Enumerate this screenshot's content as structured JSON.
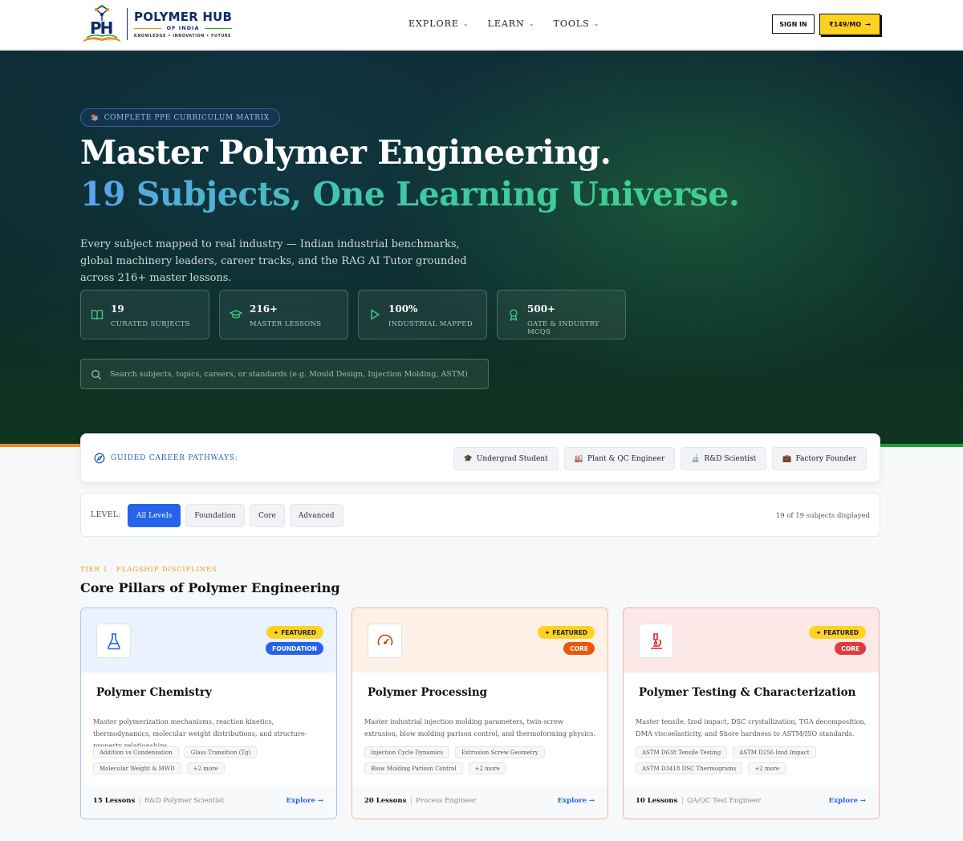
{
  "brand": {
    "name": "POLYMER HUB",
    "sub": "OF INDIA",
    "tagline": "KNOWLEDGE • INNOVATION • FUTURE",
    "mark_letters": "PH"
  },
  "nav": {
    "items": [
      {
        "label": "EXPLORE"
      },
      {
        "label": "LEARN"
      },
      {
        "label": "TOOLS"
      }
    ],
    "signin_label": "SIGN IN",
    "price_label": "₹149/MO",
    "price_arrow": "→"
  },
  "hero": {
    "pill_icon": "📚",
    "pill_label": "COMPLETE PPE CURRICULUM MATRIX",
    "title_line1": "Master Polymer Engineering.",
    "title_line2": "19 Subjects, One Learning Universe.",
    "description": "Every subject mapped to real industry — Indian industrial benchmarks, global machinery leaders, career tracks, and the RAG AI Tutor grounded across 216+ master lessons.",
    "stats": [
      {
        "value": "19",
        "label": "CURATED SUBJECTS",
        "icon": "book-icon"
      },
      {
        "value": "216+",
        "label": "MASTER LESSONS",
        "icon": "graduation-cap-icon"
      },
      {
        "value": "100%",
        "label": "INDUSTRIAL MAPPED",
        "icon": "play-icon"
      },
      {
        "value": "500+",
        "label": "GATE & INDUSTRY MCQS",
        "icon": "award-icon"
      }
    ],
    "search_placeholder": "Search subjects, topics, careers, or standards (e.g. Mould Design, Injection Molding, ASTM)"
  },
  "pathways": {
    "label": "GUIDED CAREER PATHWAYS:",
    "items": [
      {
        "icon": "🎓",
        "label": "Undergrad Student"
      },
      {
        "icon": "🏭",
        "label": "Plant & QC Engineer"
      },
      {
        "icon": "🔬",
        "label": "R&D Scientist"
      },
      {
        "icon": "💼",
        "label": "Factory Founder"
      }
    ]
  },
  "levels": {
    "label": "LEVEL:",
    "options": [
      "All Levels",
      "Foundation",
      "Core",
      "Advanced"
    ],
    "selected": "All Levels",
    "count_text": "19 of 19 subjects displayed"
  },
  "tier": {
    "label": "TIER 1 · FLAGSHIP DISCIPLINES",
    "title": "Core Pillars of Polymer Engineering"
  },
  "cards": [
    {
      "title": "Polymer Chemistry",
      "featured_label": "FEATURED",
      "level": "FOUNDATION",
      "level_color": "#2563eb",
      "top_bg": "#eaf2fd",
      "border": "#a9c6ef",
      "icon": "flask-icon",
      "icon_color": "#2563eb",
      "description": "Master polymerization mechanisms, reaction kinetics, thermodynamics, molecular weight distributions, and structure-property relationships.",
      "tags": [
        "Addition vs Condensation",
        "Glass Transition (Tg)",
        "Molecular Weight & MWD",
        "+2 more"
      ],
      "lessons": "15 Lessons",
      "role": "R&D Polymer Scientist",
      "explore": "Explore →"
    },
    {
      "title": "Polymer Processing",
      "featured_label": "FEATURED",
      "level": "CORE",
      "level_color": "#ea580c",
      "top_bg": "#fdf0e6",
      "border": "#f2b99a",
      "icon": "gauge-icon",
      "icon_color": "#c2410c",
      "description": "Master industrial injection molding parameters, twin-screw extrusion, blow molding parison control, and thermoforming physics.",
      "tags": [
        "Injection Cycle Dynamics",
        "Extrusion Screw Geometry",
        "Blow Molding Parison Control",
        "+2 more"
      ],
      "lessons": "20 Lessons",
      "role": "Process Engineer",
      "explore": "Explore →"
    },
    {
      "title": "Polymer Testing & Characterization",
      "featured_label": "FEATURED",
      "level": "CORE",
      "level_color": "#e23b3b",
      "top_bg": "#fde8e8",
      "border": "#f3b0b0",
      "icon": "microscope-icon",
      "icon_color": "#dc2626",
      "description": "Master tensile, Izod impact, DSC crystallization, TGA decomposition, DMA viscoelasticity, and Shore hardness to ASTM/ISO standards.",
      "tags": [
        "ASTM D638 Tensile Testing",
        "ASTM D256 Izod Impact",
        "ASTM D3418 DSC Thermograms",
        "+2 more"
      ],
      "lessons": "10 Lessons",
      "role": "QA/QC Test Engineer",
      "explore": "Explore →"
    }
  ]
}
